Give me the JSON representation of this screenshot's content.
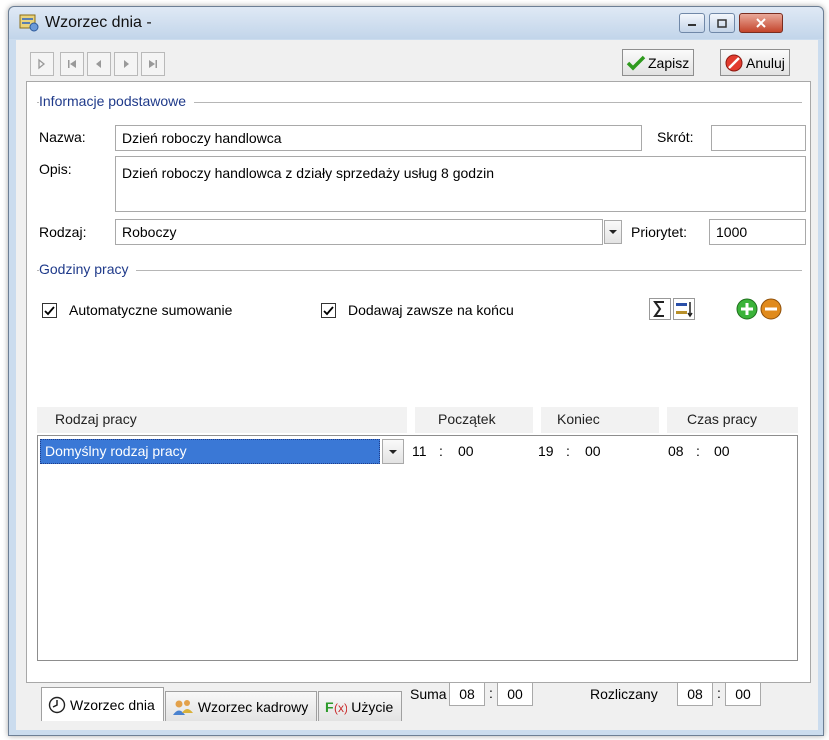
{
  "window": {
    "title": "Wzorzec dnia -"
  },
  "toolbar": {
    "save_label": "Zapisz",
    "cancel_label": "Anuluj"
  },
  "basic": {
    "section_title": "Informacje podstawowe",
    "name_label": "Nazwa:",
    "name_value": "Dzień roboczy handlowca",
    "short_label": "Skrót:",
    "short_value": "",
    "desc_label": "Opis:",
    "desc_value": "Dzień roboczy handlowca z działy sprzedaży usług 8 godzin",
    "type_label": "Rodzaj:",
    "type_value": "Roboczy",
    "priority_label": "Priorytet:",
    "priority_value": "1000"
  },
  "hours": {
    "section_title": "Godziny pracy",
    "auto_sum_label": "Automatyczne sumowanie",
    "auto_sum_checked": true,
    "append_label": "Dodawaj zawsze na końcu",
    "append_checked": true,
    "columns": [
      "Rodzaj pracy",
      "Początek",
      "Koniec",
      "Czas pracy"
    ],
    "rows": [
      {
        "work_type": "Domyślny rodzaj pracy",
        "start_h": "11",
        "start_m": "00",
        "end_h": "19",
        "end_m": "00",
        "dur_h": "08",
        "dur_m": "00"
      }
    ]
  },
  "summary": {
    "sum_label": "Suma",
    "sum_h": "08",
    "sum_m": "00",
    "settled_label": "Rozliczany",
    "settled_h": "08",
    "settled_m": "00"
  },
  "tabs": [
    {
      "label": "Wzorzec dnia",
      "active": true,
      "icon": "clock-icon"
    },
    {
      "label": "Wzorzec kadrowy",
      "active": false,
      "icon": "people-icon"
    },
    {
      "label": "Użycie",
      "active": false,
      "icon": "function-icon"
    }
  ],
  "colors": {
    "accent_blue": "#1f3a8a",
    "selection": "#3a78d6",
    "window_frame": "#cbdcee"
  }
}
